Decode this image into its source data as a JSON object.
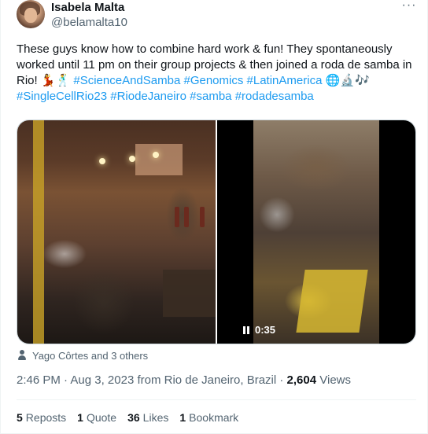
{
  "author": {
    "name": "Isabela Malta",
    "handle": "@belamalta10"
  },
  "more_label": "···",
  "tweet_text": {
    "body": "These guys know how to combine hard work & fun! They spontaneously worked until 11 pm on their group projects & then joined a roda de samba in Rio! 💃🕺 ",
    "hashtags": [
      "#ScienceAndSamba",
      "#Genomics",
      "#LatinAmerica",
      "#SingleCellRio23",
      "#RiodeJaneiro",
      "#samba",
      "#rodadesamba"
    ],
    "emoji_after_latinamerica": "🌐🔬🎶"
  },
  "media": {
    "video_time": "0:35"
  },
  "tagged_people": "Yago Côrtes and 3 others",
  "meta": {
    "time": "2:46 PM",
    "date": "Aug 3, 2023",
    "location": "from Rio de Janeiro, Brazil",
    "separator": "·",
    "views_count": "2,604",
    "views_label": "Views"
  },
  "stats": {
    "reposts_count": "5",
    "reposts_label": "Reposts",
    "quotes_count": "1",
    "quotes_label": "Quote",
    "likes_count": "36",
    "likes_label": "Likes",
    "bookmarks_count": "1",
    "bookmarks_label": "Bookmark"
  }
}
